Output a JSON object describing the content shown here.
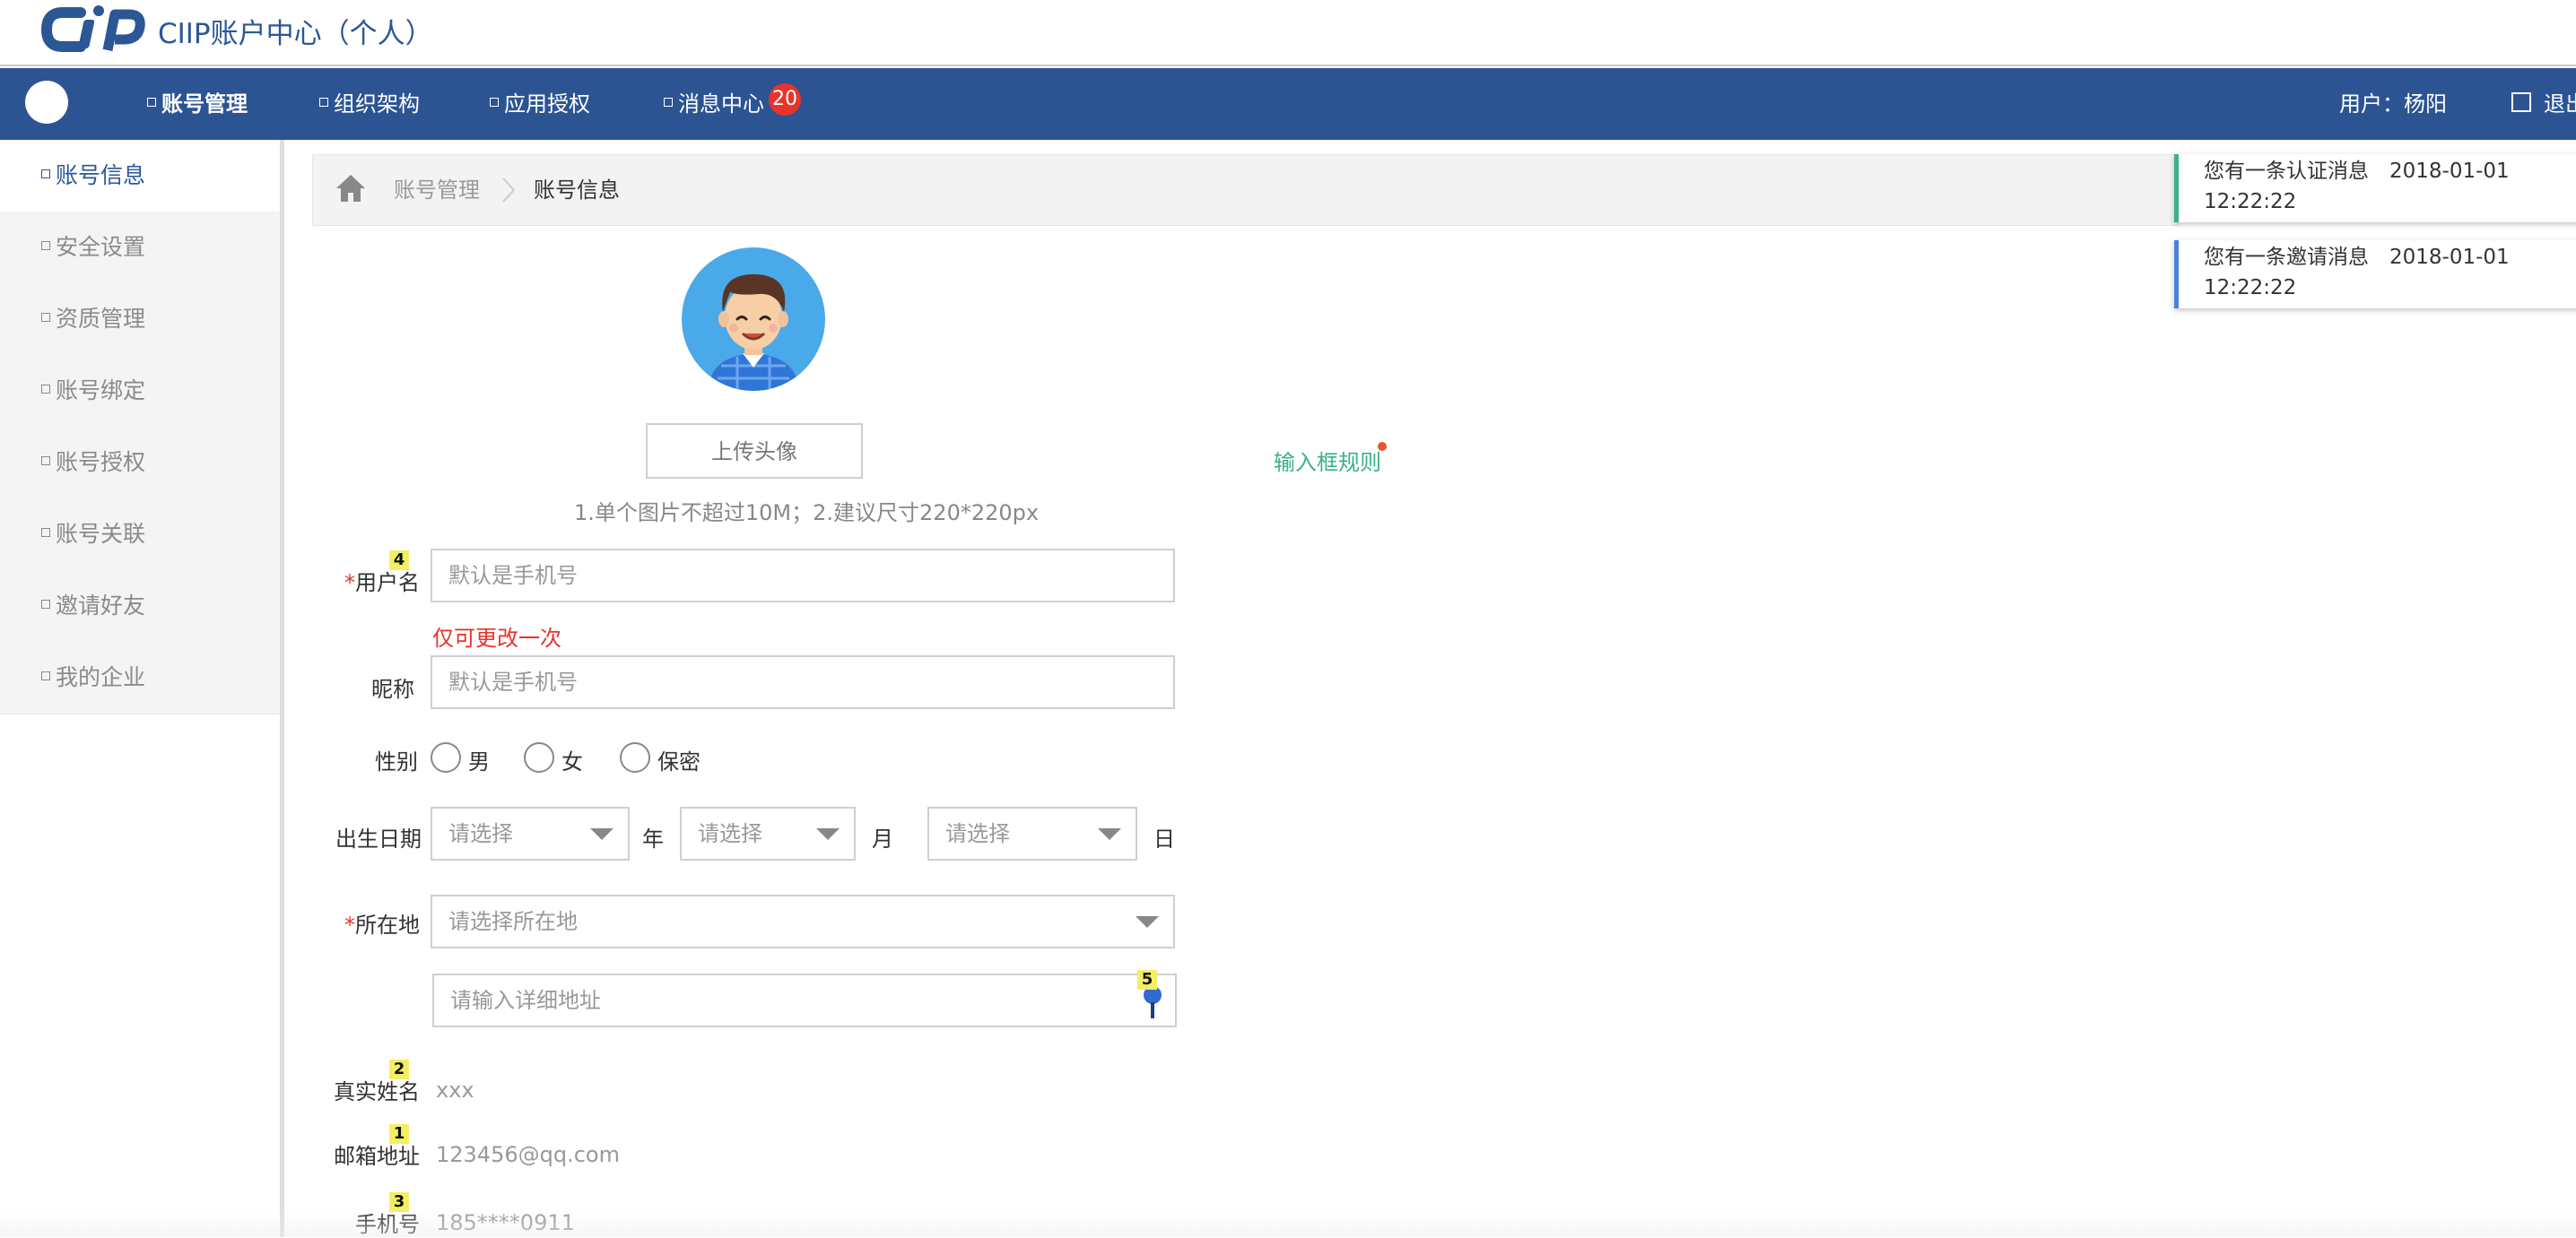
{
  "brand": {
    "title": "CIIP账户中心（个人）"
  },
  "nav": {
    "items": [
      {
        "label": "账号管理"
      },
      {
        "label": "组织架构"
      },
      {
        "label": "应用授权"
      },
      {
        "label": "消息中心"
      }
    ],
    "badge": "20",
    "user": "用户：杨阳",
    "logout": "退出"
  },
  "sidebar": {
    "items": [
      {
        "label": "账号信息"
      },
      {
        "label": "安全设置"
      },
      {
        "label": "资质管理"
      },
      {
        "label": "账号绑定"
      },
      {
        "label": "账号授权"
      },
      {
        "label": "账号关联"
      },
      {
        "label": "邀请好友"
      },
      {
        "label": "我的企业"
      }
    ]
  },
  "breadcrumb": {
    "parent": "账号管理",
    "current": "账号信息"
  },
  "notifications": [
    {
      "text": "您有一条认证消息　2018-01-01 12:22:22"
    },
    {
      "text": "您有一条邀请消息　2018-01-01 12:22:22"
    }
  ],
  "profile": {
    "upload_button": "上传头像",
    "upload_hint": "1.单个图片不超过10M；2.建议尺寸220*220px",
    "rule_link": "输入框规则"
  },
  "form": {
    "required_mark": "*",
    "username": {
      "label": "用户名",
      "placeholder": "默认是手机号",
      "hint": "仅可更改一次"
    },
    "nickname": {
      "label": "昵称",
      "placeholder": "默认是手机号"
    },
    "gender": {
      "label": "性别",
      "options": [
        "男",
        "女",
        "保密"
      ]
    },
    "birthday": {
      "label": "出生日期",
      "year_placeholder": "请选择",
      "year_unit": "年",
      "month_placeholder": "请选择",
      "month_unit": "月",
      "day_placeholder": "请选择",
      "day_unit": "日"
    },
    "location": {
      "label": "所在地",
      "placeholder": "请选择所在地",
      "detail_placeholder": "请输入详细地址"
    },
    "real_name": {
      "label": "真实姓名",
      "value": "xxx"
    },
    "email": {
      "label": "邮箱地址",
      "value": "123456@qq.com"
    },
    "phone": {
      "label": "手机号",
      "value": "185****0911"
    }
  },
  "markers": [
    "4",
    "5",
    "2",
    "1",
    "3"
  ],
  "colors": {
    "nav_bg": "#2d5492",
    "brand_blue": "#2b5797",
    "required_red": "#e8332a",
    "link_green": "#3ab08c",
    "badge_red": "#e8332a"
  }
}
